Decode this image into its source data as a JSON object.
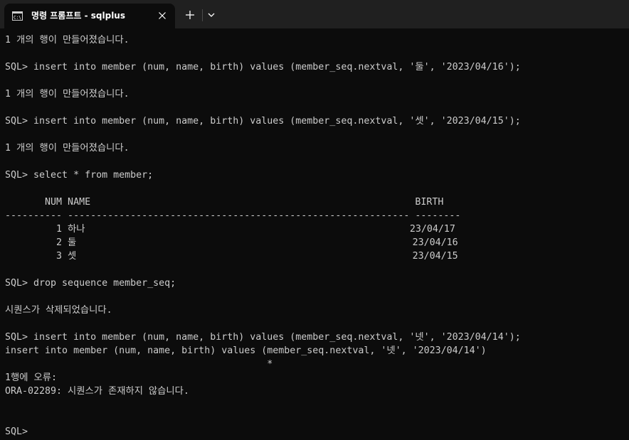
{
  "titlebar": {
    "tab_title": "명령 프롬프트 - sqlplus"
  },
  "icons": {
    "tab_icon": "command-prompt-icon",
    "close": "close-icon",
    "new_tab": "plus-icon",
    "dropdown": "chevron-down-icon"
  },
  "colors": {
    "background": "#0c0c0c",
    "titlebar": "#202020",
    "text": "#cccccc"
  },
  "console": {
    "lines": [
      "1 개의 행이 만들어졌습니다.",
      "",
      "SQL> insert into member (num, name, birth) values (member_seq.nextval, '둘', '2023/04/16');",
      "",
      "1 개의 행이 만들어졌습니다.",
      "",
      "SQL> insert into member (num, name, birth) values (member_seq.nextval, '셋', '2023/04/15');",
      "",
      "1 개의 행이 만들어졌습니다.",
      "",
      "SQL> select * from member;",
      "",
      "       NUM NAME                                                         BIRTH",
      "---------- ------------------------------------------------------------ --------",
      "         1 하나                                                         23/04/17",
      "         2 둘                                                           23/04/16",
      "         3 셋                                                           23/04/15",
      "",
      "SQL> drop sequence member_seq;",
      "",
      "시퀀스가 삭제되었습니다.",
      "",
      "SQL> insert into member (num, name, birth) values (member_seq.nextval, '넷', '2023/04/14');",
      "insert into member (num, name, birth) values (member_seq.nextval, '넷', '2023/04/14')",
      "                                              *",
      "1행에 오류:",
      "ORA-02289: 시퀀스가 존재하지 않습니다.",
      "",
      "",
      "SQL>"
    ]
  }
}
